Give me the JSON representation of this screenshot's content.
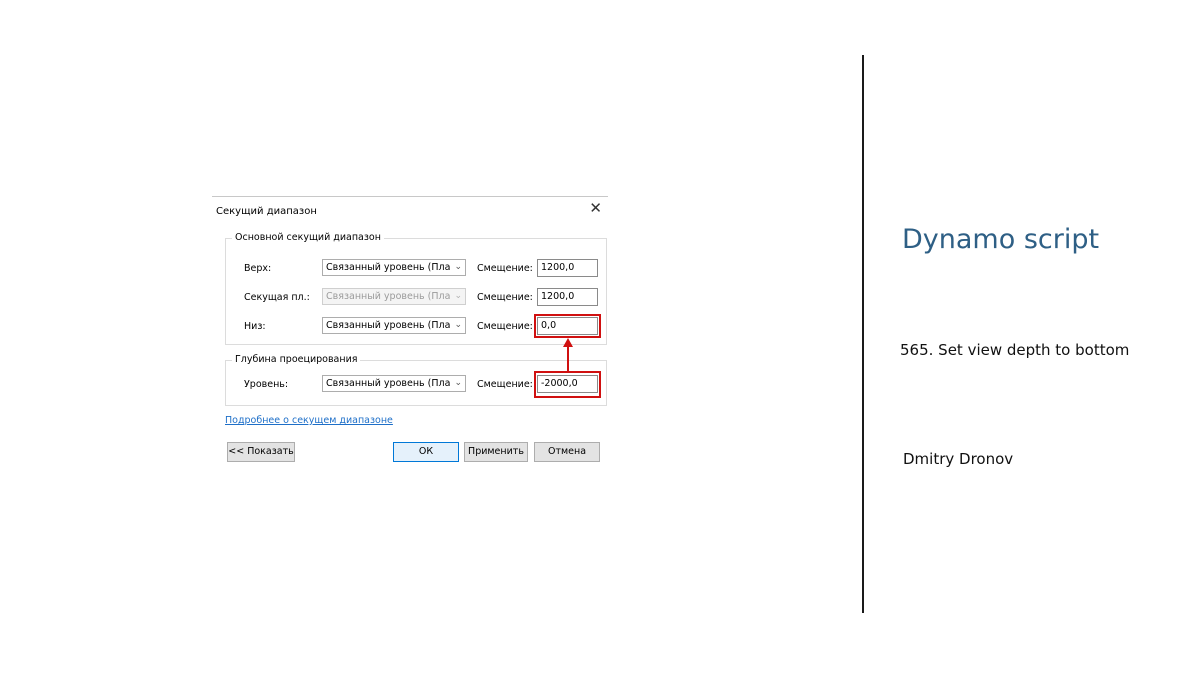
{
  "dialog": {
    "title": "Секущий диапазон",
    "close_glyph": "✕",
    "main_group": {
      "legend": "Основной секущий диапазон",
      "rows": [
        {
          "label": "Верх:",
          "level": "Связанный уровень (План",
          "offset_label": "Смещение:",
          "offset": "1200,0",
          "disabled": false
        },
        {
          "label": "Секущая пл.:",
          "level": "Связанный уровень (План",
          "offset_label": "Смещение:",
          "offset": "1200,0",
          "disabled": true
        },
        {
          "label": "Низ:",
          "level": "Связанный уровень (План",
          "offset_label": "Смещение:",
          "offset": "0,0",
          "disabled": false
        }
      ]
    },
    "depth_group": {
      "legend": "Глубина проецирования",
      "row": {
        "label": "Уровень:",
        "level": "Связанный уровень (План",
        "offset_label": "Смещение:",
        "offset": "-2000,0"
      }
    },
    "link": "Подробнее о секущем диапазоне",
    "buttons": {
      "show": "<< Показать",
      "ok": "ОК",
      "apply": "Применить",
      "cancel": "Отмена"
    },
    "dropdown_arrow": "⌄"
  },
  "panel": {
    "heading": "Dynamo script",
    "subtitle": "565. Set view depth to bottom",
    "author": "Dmitry Dronov"
  },
  "colors": {
    "highlight": "#d01010",
    "heading": "#2e5f85",
    "link": "#1e6fc8"
  }
}
